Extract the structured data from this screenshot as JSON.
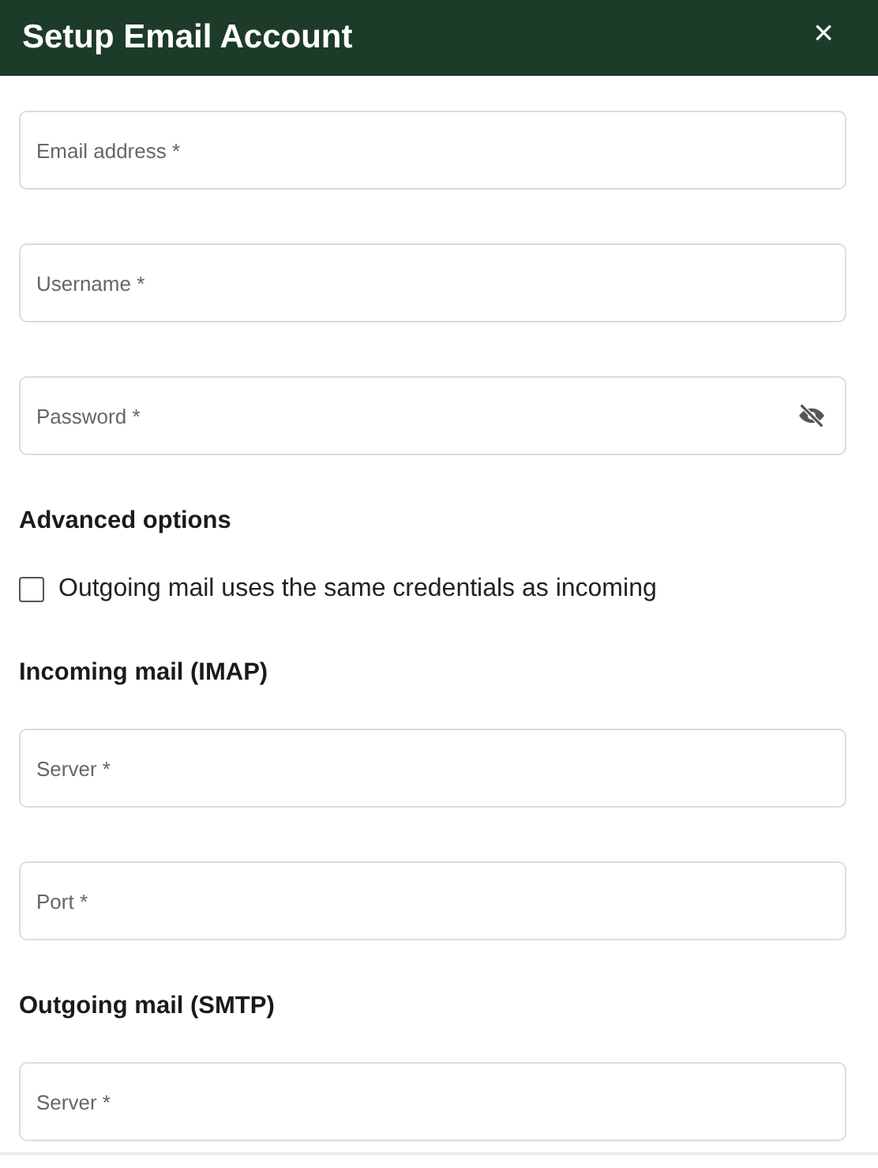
{
  "dialog": {
    "title": "Setup Email Account",
    "close": "×"
  },
  "items": [
    {
      "kind": "field",
      "placeholder": "Email address *"
    },
    {
      "kind": "field",
      "placeholder": "Username *"
    },
    {
      "kind": "password",
      "placeholder": "Password *"
    },
    {
      "kind": "heading",
      "text": "Advanced options"
    },
    {
      "kind": "checkbox",
      "label": "Outgoing mail uses the same credentials as incoming",
      "checked": false
    },
    {
      "kind": "heading",
      "text": "Incoming mail (IMAP)"
    },
    {
      "kind": "field",
      "placeholder": "Server *"
    },
    {
      "kind": "field",
      "placeholder": "Port *"
    },
    {
      "kind": "heading",
      "text": "Outgoing mail (SMTP)"
    },
    {
      "kind": "field",
      "placeholder": "Server *"
    }
  ]
}
